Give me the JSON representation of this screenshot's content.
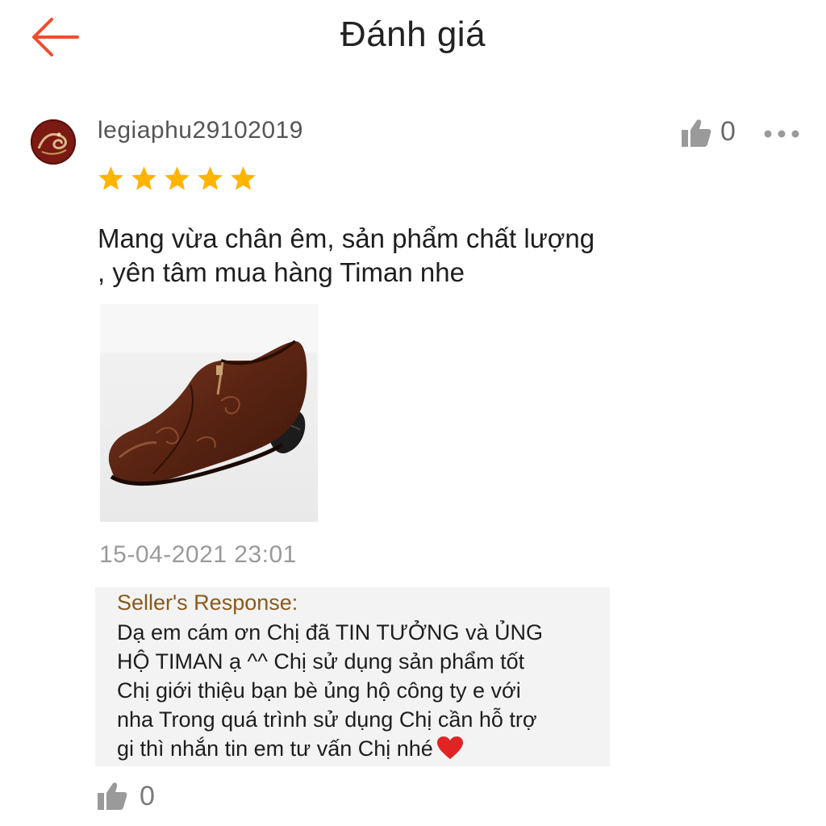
{
  "header": {
    "title": "Đánh giá",
    "back_icon": "arrow-left-icon",
    "accent_color": "#ee4d2d"
  },
  "review": {
    "username": "legiaphu29102019",
    "like_count": "0",
    "rating": 5,
    "star_color": "#ffb400",
    "text_line1": "Mang vừa chân êm, sản phẩm chất lượng",
    "text_line2": ", yên tâm mua hàng Timan nhe",
    "date": "15-04-2021 23:01"
  },
  "seller_response": {
    "label": "Seller's Response:",
    "line1": "Dạ em cám ơn  Chị  đã TIN TƯỞNG và ỦNG",
    "line2": "HỘ TIMAN ạ ^^  Chị sử dụng sản phẩm tốt",
    "line3": "Chị  giới thiệu bạn bè ủng hộ công ty e với",
    "line4": "nha Trong quá trình sử dụng  Chị  cần hỗ trợ",
    "line5": "gi thì nhắn tin em tư vấn  Chị  nhé",
    "heart_icon": "heart-icon"
  },
  "response_likes": {
    "count": "0"
  }
}
